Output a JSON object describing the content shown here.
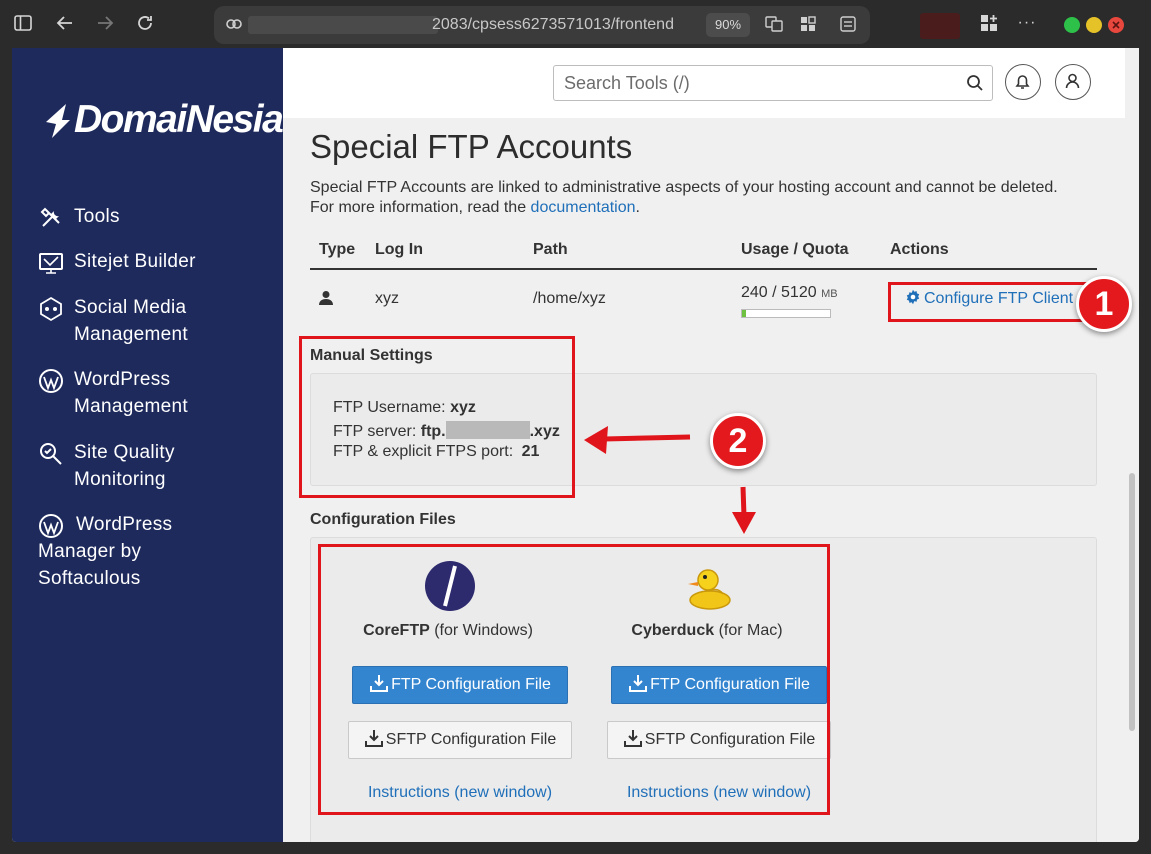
{
  "browser": {
    "url_visible": "2083/cpsess6273571013/frontend",
    "zoom": "90%"
  },
  "sidebar": {
    "brand": "DomaiNesia",
    "items": [
      {
        "label": "Tools",
        "icon": "tools-icon"
      },
      {
        "label": "Sitejet Builder",
        "icon": "sitejet-icon"
      },
      {
        "label": "Social Media Management",
        "icon": "social-media-icon"
      },
      {
        "label": "WordPress Management",
        "icon": "wordpress-icon"
      },
      {
        "label": "Site Quality Monitoring",
        "icon": "site-quality-icon"
      },
      {
        "label": "WordPress Manager by Softaculous",
        "icon": "wordpress-icon"
      }
    ]
  },
  "header": {
    "search_placeholder": "Search Tools (/)"
  },
  "page": {
    "title": "Special FTP Accounts",
    "description_1": "Special FTP Accounts are linked to administrative aspects of your hosting account and cannot be deleted.",
    "description_2_prefix": "For more information, read the ",
    "description_link": "documentation",
    "description_2_suffix": "."
  },
  "table": {
    "headers": [
      "Type",
      "Log In",
      "Path",
      "Usage / Quota",
      "Actions"
    ],
    "rows": [
      {
        "type_icon": "user-icon",
        "login": "xyz",
        "path": "/home/xyz",
        "usage": "240 / 5120",
        "usage_unit": "MB",
        "usage_fraction": 0.047,
        "action_label": "Configure FTP Client"
      }
    ]
  },
  "manual_settings": {
    "title": "Manual Settings",
    "username_label": "FTP Username:",
    "username_value": "xyz",
    "server_label": "FTP server:",
    "server_prefix": "ftp.",
    "server_suffix": ".xyz",
    "port_label": "FTP & explicit FTPS port:",
    "port_value": "21"
  },
  "config_files": {
    "title": "Configuration Files",
    "clients": [
      {
        "name": "CoreFTP",
        "platform": "(for Windows)",
        "ftp_button": "FTP Configuration File",
        "sftp_button": "SFTP Configuration File",
        "instructions": "Instructions (new window)"
      },
      {
        "name": "Cyberduck",
        "platform": "(for Mac)",
        "ftp_button": "FTP Configuration File",
        "sftp_button": "SFTP Configuration File",
        "instructions": "Instructions (new window)"
      }
    ]
  },
  "annotations": {
    "badge_1": "1",
    "badge_2": "2",
    "color": "#e0151b"
  },
  "colors": {
    "sidebar_bg": "#1e2a5c",
    "link": "#1f6fb9",
    "primary_button": "#3385d0"
  }
}
